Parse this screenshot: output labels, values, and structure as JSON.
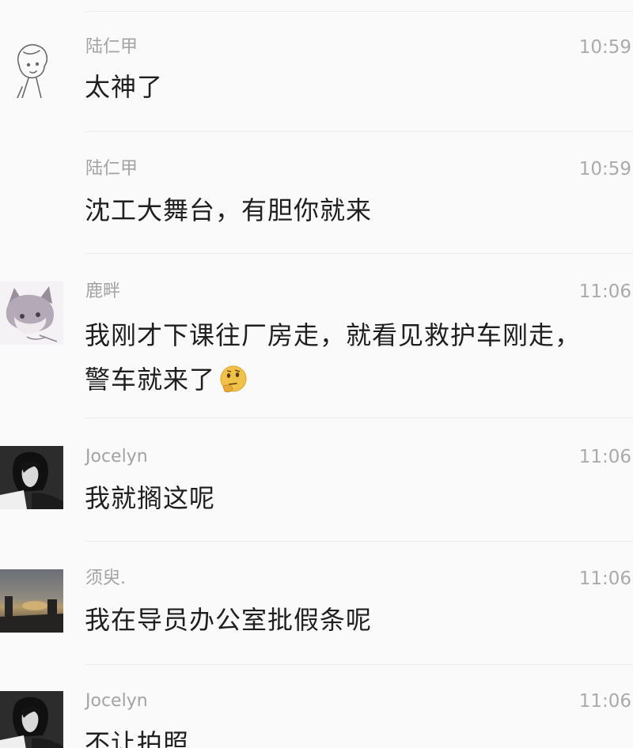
{
  "messages": [
    {
      "sender": "陆仁甲",
      "time": "10:59",
      "text": "太神了",
      "avatar": "sketch-boy-avatar",
      "show_avatar": true
    },
    {
      "sender": "陆仁甲",
      "time": "10:59",
      "text": "沈工大舞台，有胆你就来",
      "avatar": "",
      "show_avatar": false
    },
    {
      "sender": "鹿畔",
      "time": "11:06",
      "text_line1": "我刚才下课往厂房走，就看见救护车刚走，",
      "text_line2": "警车就来了",
      "emoji": "thinking-face-emoji",
      "avatar": "anime-cat-avatar",
      "show_avatar": true
    },
    {
      "sender": "Jocelyn",
      "time": "11:06",
      "text": "我就搁这呢",
      "avatar": "bw-portrait-avatar",
      "show_avatar": true
    },
    {
      "sender": "须臾.",
      "time": "11:06",
      "text": "我在导员办公室批假条呢",
      "avatar": "sunset-photo-avatar",
      "show_avatar": true
    },
    {
      "sender": "Jocelyn",
      "time": "11:06",
      "text": "不让拍照",
      "avatar": "bw-portrait-avatar",
      "show_avatar": true
    }
  ]
}
